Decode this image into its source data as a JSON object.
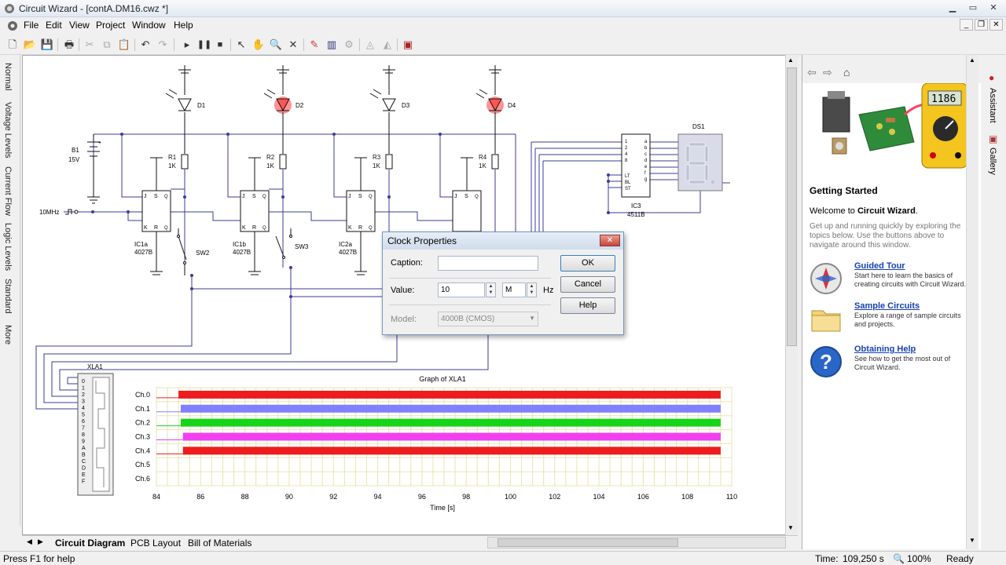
{
  "window": {
    "title": "Circuit Wizard - [contA.DM16.cwz *]"
  },
  "menu": [
    "File",
    "Edit",
    "View",
    "Project",
    "Window",
    "Help"
  ],
  "left_tabs": [
    "Normal",
    "Voltage Levels",
    "Current Flow",
    "Logic Levels",
    "Standard",
    "More"
  ],
  "circuit": {
    "leds": [
      "D1",
      "D2",
      "D3",
      "D4"
    ],
    "resistors": [
      {
        "name": "R1",
        "value": "1K"
      },
      {
        "name": "R2",
        "value": "1K"
      },
      {
        "name": "R3",
        "value": "1K"
      },
      {
        "name": "R4",
        "value": "1K"
      }
    ],
    "battery": {
      "name": "B1",
      "value": "15V",
      "plus": "+"
    },
    "clock_label": "10MHz",
    "flipflops": [
      {
        "name": "IC1a",
        "part": "4027B"
      },
      {
        "name": "IC1b",
        "part": "4027B"
      },
      {
        "name": "IC2a",
        "part": "4027B"
      }
    ],
    "ff_pins": [
      "J",
      "S",
      "Q",
      "K",
      "R",
      "Q"
    ],
    "switches": [
      "SW2",
      "SW3"
    ],
    "decoder": {
      "name": "IC3",
      "part": "4511B",
      "inputs": [
        "1",
        "2",
        "4",
        "8"
      ],
      "controls": [
        "LT",
        "BL",
        "ST"
      ],
      "outputs": [
        "a",
        "b",
        "c",
        "d",
        "e",
        "f",
        "g"
      ]
    },
    "display": {
      "name": "DS1"
    },
    "analyzer": {
      "name": "XLA1",
      "pins": [
        "0",
        "1",
        "2",
        "3",
        "4",
        "5",
        "6",
        "7",
        "8",
        "9",
        "A",
        "B",
        "C",
        "D",
        "E",
        "F"
      ]
    }
  },
  "graph": {
    "title": "Graph of XLA1",
    "xlabel": "Time [s]"
  },
  "chart_data": {
    "type": "timing",
    "title": "Graph of XLA1",
    "xlabel": "Time [s]",
    "xlim": [
      84,
      110
    ],
    "x_ticks": [
      84,
      86,
      88,
      90,
      92,
      94,
      96,
      98,
      100,
      102,
      104,
      106,
      108,
      110
    ],
    "grid": true,
    "series": [
      {
        "name": "Ch.0",
        "color": "#ee1c1c",
        "start": 85.0,
        "end": 109.5
      },
      {
        "name": "Ch.1",
        "color": "#8080ff",
        "start": 85.1,
        "end": 109.5
      },
      {
        "name": "Ch.2",
        "color": "#18d418",
        "start": 85.1,
        "end": 109.5
      },
      {
        "name": "Ch.3",
        "color": "#f040f0",
        "start": 85.2,
        "end": 109.5
      },
      {
        "name": "Ch.4",
        "color": "#ee1c1c",
        "start": 85.2,
        "end": 109.5
      },
      {
        "name": "Ch.5",
        "color": "#ffffff",
        "start": null,
        "end": null
      },
      {
        "name": "Ch.6",
        "color": "#ffffff",
        "start": null,
        "end": null
      }
    ]
  },
  "tabs": [
    "Circuit Diagram",
    "PCB Layout",
    "Bill of Materials"
  ],
  "status": {
    "help": "Press F1 for help",
    "time_label": "Time:",
    "time_value": "109,250 s",
    "zoom": "100%",
    "state": "Ready"
  },
  "assistant": {
    "title": "Getting Started",
    "welcome_prefix": "Welcome to ",
    "welcome_app": "Circuit Wizard",
    "welcome_suffix": ".",
    "intro": "Get up and running quickly by exploring the topics below. Use the buttons above to navigate around this window.",
    "meter_display": "1186",
    "items": [
      {
        "title": "Guided Tour",
        "desc": "Start here to learn the basics of creating circuits with Circuit Wizard."
      },
      {
        "title": "Sample Circuits",
        "desc": "Explore a range of sample circuits and projects."
      },
      {
        "title": "Obtaining Help",
        "desc": "See how to get the most out of Circuit Wizard."
      }
    ]
  },
  "right_tabs": [
    "Assistant",
    "Gallery"
  ],
  "dialog": {
    "title": "Clock Properties",
    "caption_label": "Caption:",
    "caption_value": "",
    "value_label": "Value:",
    "value": "10",
    "unit_prefix": "M",
    "unit": "Hz",
    "model_label": "Model:",
    "model_value": "4000B (CMOS)",
    "ok": "OK",
    "cancel": "Cancel",
    "help": "Help"
  },
  "colors": {
    "led_on": "#ff3b3b",
    "wire": "#3b3b9a",
    "grid": "#e8e6b0",
    "accent": "#1740b3"
  }
}
